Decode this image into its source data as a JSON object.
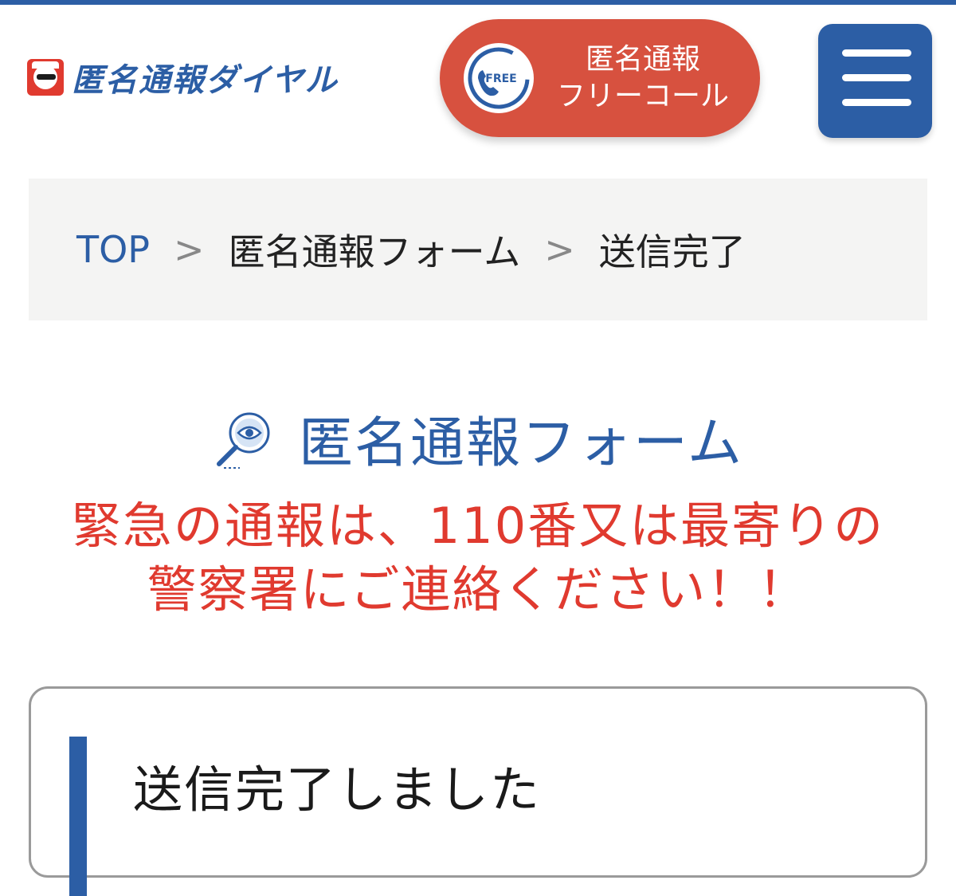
{
  "header": {
    "logo_text": "匿名通報ダイヤル",
    "free_badge_text": "FREE",
    "free_call_line1": "匿名通報",
    "free_call_line2": "フリーコール"
  },
  "breadcrumb": {
    "items": [
      "TOP",
      "匿名通報フォーム",
      "送信完了"
    ],
    "separator": ">"
  },
  "main": {
    "heading": "匿名通報フォーム",
    "notice_line1": "緊急の通報は、110番又は最寄りの",
    "notice_line2": "警察署にご連絡ください！！",
    "card_title": "送信完了しました"
  },
  "colors": {
    "brand_blue": "#2c5ea5",
    "accent_red": "#e03a2f",
    "free_call_red": "#d7513f"
  },
  "icons": {
    "menu": "hamburger-icon",
    "phone": "phone-icon",
    "heading": "magnifier-eye-icon"
  }
}
